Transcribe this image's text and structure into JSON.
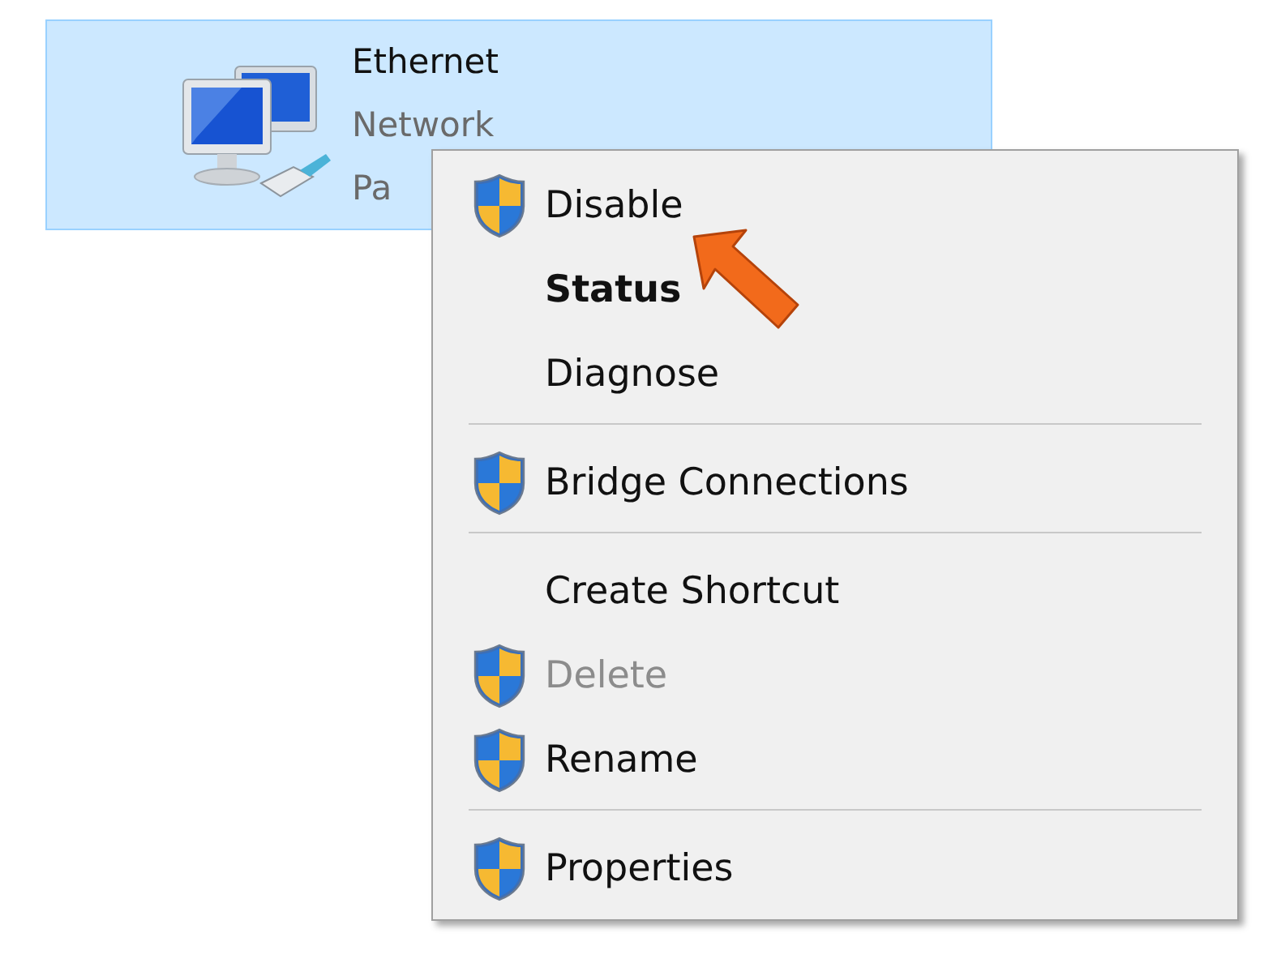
{
  "adapter": {
    "selected": true,
    "name": "Ethernet",
    "status": "Network",
    "device": "Pa"
  },
  "context_menu": {
    "items": [
      {
        "kind": "item",
        "label": "Disable",
        "shield": true,
        "default": false,
        "disabled": false
      },
      {
        "kind": "item",
        "label": "Status",
        "shield": false,
        "default": true,
        "disabled": false
      },
      {
        "kind": "item",
        "label": "Diagnose",
        "shield": false,
        "default": false,
        "disabled": false
      },
      {
        "kind": "separator"
      },
      {
        "kind": "item",
        "label": "Bridge Connections",
        "shield": true,
        "default": false,
        "disabled": false
      },
      {
        "kind": "separator"
      },
      {
        "kind": "item",
        "label": "Create Shortcut",
        "shield": false,
        "default": false,
        "disabled": false
      },
      {
        "kind": "item",
        "label": "Delete",
        "shield": true,
        "default": false,
        "disabled": true
      },
      {
        "kind": "item",
        "label": "Rename",
        "shield": true,
        "default": false,
        "disabled": false
      },
      {
        "kind": "separator"
      },
      {
        "kind": "item",
        "label": "Properties",
        "shield": true,
        "default": false,
        "disabled": false
      }
    ]
  }
}
